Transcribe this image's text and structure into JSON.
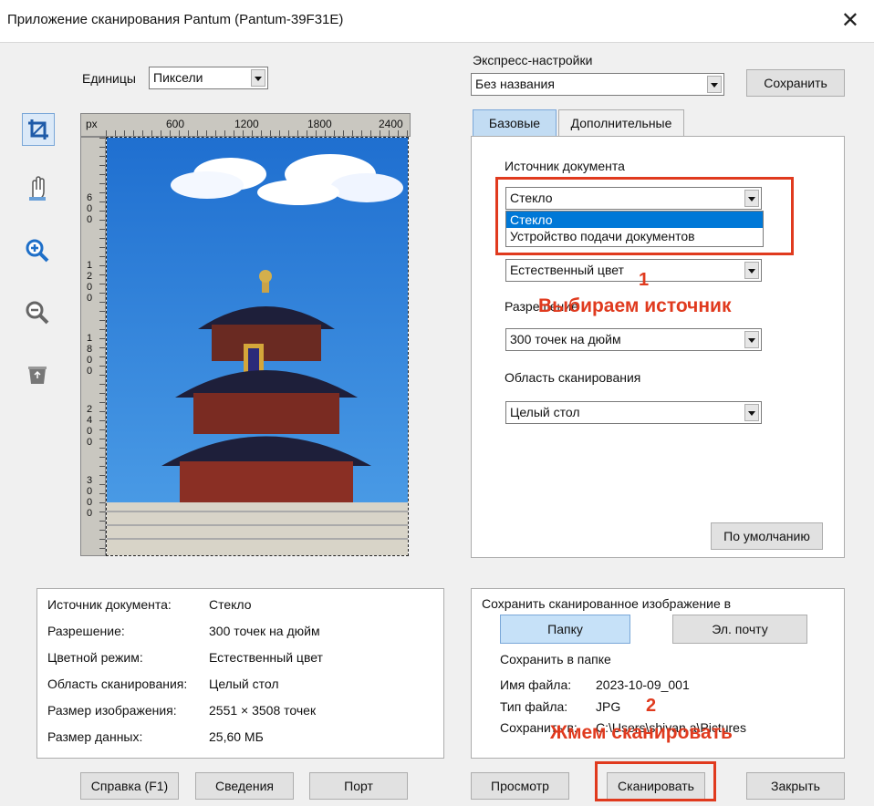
{
  "window": {
    "title": "Приложение сканирования Pantum (Pantum-39F31E)",
    "close_glyph": "✕"
  },
  "units": {
    "label": "Единицы",
    "value": "Пиксели"
  },
  "ruler": {
    "unit": "px",
    "top_ticks": [
      "600",
      "1200",
      "1800",
      "2400"
    ],
    "left_ticks": [
      "6\n0\n0",
      "1\n2\n0\n0",
      "1\n8\n0\n0",
      "2\n4\n0\n0",
      "3\n0\n0\n0"
    ]
  },
  "tools": [
    "crop-icon",
    "hand-icon",
    "zoom-in-icon",
    "zoom-out-icon",
    "recycle-bin-icon"
  ],
  "express": {
    "label": "Экспресс-настройки",
    "value": "Без названия",
    "save_label": "Сохранить"
  },
  "tabs": {
    "basic": "Базовые",
    "advanced": "Дополнительные"
  },
  "settings": {
    "source_label": "Источник документа",
    "source_value": "Стекло",
    "source_options": [
      "Стекло",
      "Устройство подачи документов"
    ],
    "color_value": "Естественный цвет",
    "resolution_label": "Разрешение",
    "resolution_value": "300 точек на дюйм",
    "area_label": "Область сканирования",
    "area_value": "Целый стол",
    "default_label": "По умолчанию"
  },
  "summary": {
    "rows": [
      {
        "k": "Источник документа:",
        "v": "Стекло"
      },
      {
        "k": "Разрешение:",
        "v": "300 точек на дюйм"
      },
      {
        "k": "Цветной режим:",
        "v": "Естественный цвет"
      },
      {
        "k": "Область сканирования:",
        "v": "Целый стол"
      },
      {
        "k": "Размер изображения:",
        "v": "2551 × 3508 точек"
      },
      {
        "k": "Размер данных:",
        "v": "25,60 МБ"
      }
    ]
  },
  "save": {
    "title": "Сохранить сканированное изображение в",
    "folder_btn": "Папку",
    "email_btn": "Эл. почту",
    "folder_title": "Сохранить в папке",
    "file_name_label": "Имя файла:",
    "file_name": "2023-10-09_001",
    "file_type_label": "Тип файла:",
    "file_type": "JPG",
    "save_in_label": "Сохранить в:",
    "save_in": "C:\\Users\\shivan.a\\Pictures"
  },
  "buttons": {
    "help": "Справка (F1)",
    "info": "Сведения",
    "port": "Порт",
    "preview": "Просмотр",
    "scan": "Сканировать",
    "close": "Закрыть"
  },
  "annotations": {
    "n1": "1",
    "t1": "Выбираем источник",
    "n2": "2",
    "t2": "Жмем сканировать"
  },
  "colors": {
    "accent_red": "#e03a1e",
    "selection_blue": "#0078d7",
    "sky": "#2d7fd4"
  }
}
